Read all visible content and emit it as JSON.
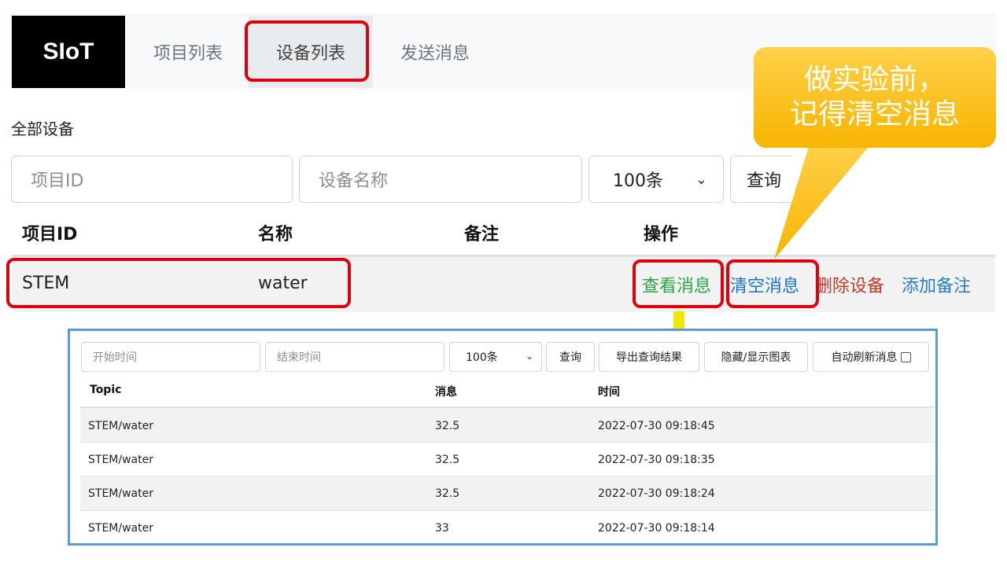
{
  "nav": {
    "brand": "SIoT",
    "links": [
      "项目列表",
      "设备列表",
      "发送消息"
    ]
  },
  "section_title": "全部设备",
  "filters": {
    "project_id_placeholder": "项目ID",
    "device_name_placeholder": "设备名称",
    "limit_value": "100条",
    "query_label": "查询"
  },
  "device_table": {
    "headers": [
      "项目ID",
      "名称",
      "备注",
      "操作"
    ],
    "rows": [
      {
        "project_id": "STEM",
        "name": "water",
        "note": ""
      }
    ],
    "actions": {
      "view": "查看消息",
      "clear": "清空消息",
      "delete": "删除设备",
      "add_note": "添加备注"
    }
  },
  "callout": {
    "line1": "做实验前，",
    "line2": "记得清空消息",
    "color": "#f7b500"
  },
  "messages_panel": {
    "start_time_placeholder": "开始时间",
    "end_time_placeholder": "结束时间",
    "limit_value": "100条",
    "query_label": "查询",
    "export_label": "导出查询结果",
    "toggle_chart_label": "隐藏/显示图表",
    "auto_refresh_label": "自动刷新消息",
    "headers": [
      "Topic",
      "消息",
      "时间"
    ],
    "rows": [
      {
        "topic": "STEM/water",
        "message": "32.5",
        "time": "2022-07-30 09:18:45"
      },
      {
        "topic": "STEM/water",
        "message": "32.5",
        "time": "2022-07-30 09:18:35"
      },
      {
        "topic": "STEM/water",
        "message": "32.5",
        "time": "2022-07-30 09:18:24"
      },
      {
        "topic": "STEM/water",
        "message": "33",
        "time": "2022-07-30 09:18:14"
      }
    ]
  },
  "colors": {
    "highlight": "#e0000c",
    "panel_border": "#5b9bd5",
    "arrow": "#f0e800"
  }
}
